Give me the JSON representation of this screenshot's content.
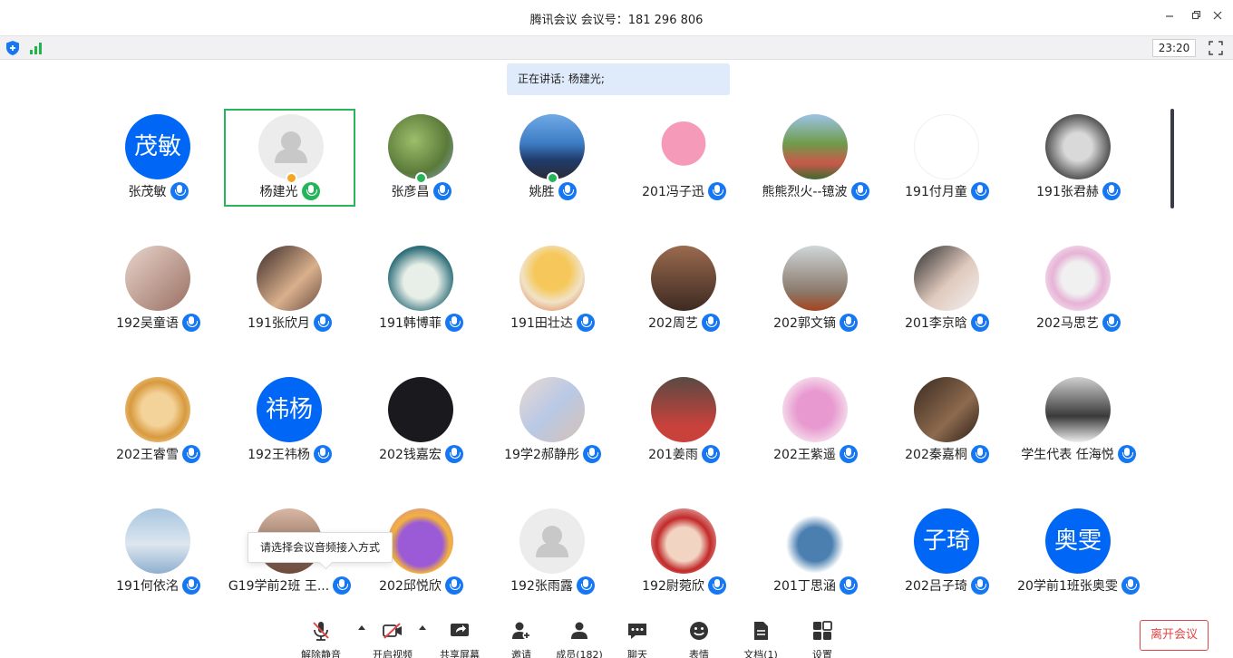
{
  "window": {
    "title": "腾讯会议 会议号：181 296 806",
    "time": "23:20"
  },
  "speaking_banner": "正在讲话: 杨建光;",
  "tooltip": "请选择会议音频接入方式",
  "colors": {
    "accent": "#0066f5",
    "active_border": "#2bb55a",
    "leave": "#e04646",
    "mic_blue": "#1677f2",
    "mic_green": "#25b45a"
  },
  "participants": [
    {
      "name": "张茂敏",
      "avatar_text": "茂敏",
      "avatar": "text"
    },
    {
      "name": "杨建光",
      "avatar": "placeholder-person",
      "active_speaker": true,
      "badge": "host-orange"
    },
    {
      "name": "张彦昌",
      "avatar": "willow-tree-photo",
      "badge": "cohost-green"
    },
    {
      "name": "姚胜",
      "avatar": "seaside-photo",
      "badge": "cohost-green"
    },
    {
      "name": "201冯子迅",
      "avatar": "pink-kirby"
    },
    {
      "name": "熊熊烈火--镱波",
      "avatar": "garden-house-photo"
    },
    {
      "name": "191付月童",
      "avatar": "white-blank"
    },
    {
      "name": "191张君赫",
      "avatar": "rabbit-cartoon"
    },
    {
      "name": "192吴童语",
      "avatar": "girl-dress-photo"
    },
    {
      "name": "191张欣月",
      "avatar": "girl-hat-photo"
    },
    {
      "name": "191韩博菲",
      "avatar": "polar-bear-photo"
    },
    {
      "name": "191田壮达",
      "avatar": "naruto-anime"
    },
    {
      "name": "202周艺",
      "avatar": "man-meme"
    },
    {
      "name": "202郭文镝",
      "avatar": "cat-costume"
    },
    {
      "name": "201李京晗",
      "avatar": "boy-photo"
    },
    {
      "name": "202马思艺",
      "avatar": "meme-face"
    },
    {
      "name": "202王睿雪",
      "avatar": "anime-character"
    },
    {
      "name": "192王祎杨",
      "avatar_text": "祎杨",
      "avatar": "text"
    },
    {
      "name": "202钱嘉宏",
      "avatar": "dark-night"
    },
    {
      "name": "19学2郝静彤",
      "avatar": "drink-bottle"
    },
    {
      "name": "201姜雨",
      "avatar": "boy-red-shirt"
    },
    {
      "name": "202王紫遥",
      "avatar": "pink-panther"
    },
    {
      "name": "202秦嘉桐",
      "avatar": "room-photo"
    },
    {
      "name": "学生代表 任海悦",
      "avatar": "penguin-toy"
    },
    {
      "name": "191何依洺",
      "avatar": "sky-clouds"
    },
    {
      "name": "G19学前2班 王...",
      "avatar": "girl-glasses"
    },
    {
      "name": "202邱悦欣",
      "avatar": "purple-cartoon"
    },
    {
      "name": "192张雨露",
      "avatar": "placeholder-person"
    },
    {
      "name": "192尉菀欣",
      "avatar": "kiki-anime"
    },
    {
      "name": "201丁思涵",
      "avatar": "snorlax-sleep"
    },
    {
      "name": "202吕子琦",
      "avatar_text": "子琦",
      "avatar": "text"
    },
    {
      "name": "20学前1班张奥雯",
      "avatar_text": "奥雯",
      "avatar": "text"
    }
  ],
  "toolbar": {
    "unmute": "解除静音",
    "start_video": "开启视频",
    "share_screen": "共享屏幕",
    "invite": "邀请",
    "members": "成员(182)",
    "chat": "聊天",
    "reactions": "表情",
    "docs": "文档(1)",
    "settings": "设置",
    "leave": "离开会议"
  }
}
